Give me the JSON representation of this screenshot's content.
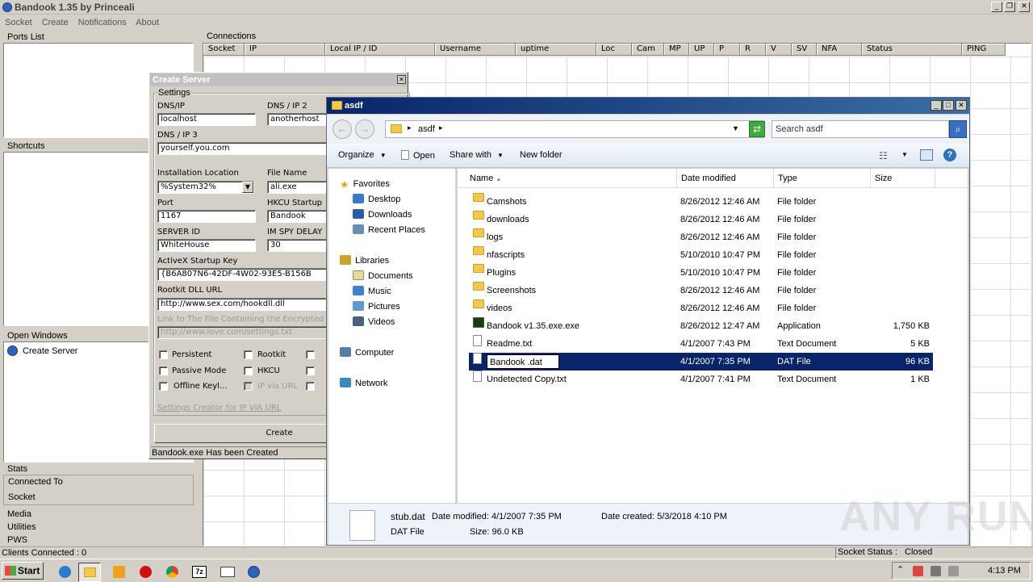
{
  "main_window": {
    "title": "Bandook 1.35 by Princeali",
    "menu": [
      "Socket",
      "Create",
      "Notifications",
      "About"
    ]
  },
  "left_panel": {
    "ports_list_label": "Ports List",
    "shortcuts_label": "Shortcuts",
    "open_windows_label": "Open Windows",
    "open_windows_items": [
      "Create Server"
    ],
    "stats_label": "Stats",
    "connected_to_label": "Connected To",
    "socket_label": "Socket",
    "shortcut_links": [
      "Media",
      "Utilities",
      "PWS"
    ]
  },
  "connections": {
    "label": "Connections",
    "columns": [
      "Socket",
      "IP",
      "Local IP / ID",
      "Username",
      "uptime",
      "Loc",
      "Cam",
      "MP",
      "UP",
      "P",
      "R",
      "V",
      "SV",
      "NFA",
      "Status",
      "PING"
    ]
  },
  "status_bar": {
    "clients": "Clients Connected : 0",
    "socket_status_label": "Socket Status :",
    "socket_status_value": "Closed"
  },
  "create_server": {
    "title": "Create Server",
    "settings_label": "Settings",
    "dns_ip_label": "DNS/IP",
    "dns_ip_value": "localhost",
    "dns_ip2_label": "DNS / IP 2",
    "dns_ip2_value": "anotherhost",
    "dns_ip3_label": "DNS / IP 3",
    "dns_ip3_value": "yourself.you.com",
    "install_location_label": "Installation Location",
    "install_location_value": "%System32%",
    "file_name_label": "File Name",
    "file_name_value": "ali.exe",
    "port_label": "Port",
    "port_value": "1167",
    "hkcu_label": "HKCU Startup",
    "hkcu_value": "Bandook",
    "server_id_label": "SERVER ID",
    "server_id_value": "WhiteHouse",
    "im_spy_label": "IM SPY DELAY",
    "im_spy_value": "30",
    "activex_label": "ActiveX Startup Key",
    "activex_value": "{B6A807N6-42DF-4W02-93E5-B156B",
    "rootkit_url_label": "Rootkit DLL URL",
    "rootkit_url_value": "http://www.sex.com/hookdll.dll",
    "link_file_label": "Link to The File Containing the Encrypted",
    "link_file_value": "http://www.love.com/settings.txt",
    "checkboxes": [
      "Persistent",
      "Rootkit",
      "Passive Mode",
      "HKCU",
      "Offline Keyl...",
      "IP via URL"
    ],
    "settings_creator_link": "Settings Creator for IP VIA URL",
    "create_button": "Create",
    "status": "Bandook.exe Has been Created"
  },
  "explorer": {
    "title": "asdf",
    "breadcrumb": "asdf",
    "search_placeholder": "Search asdf",
    "toolbar": {
      "organize": "Organize",
      "open": "Open",
      "share_with": "Share with",
      "new_folder": "New folder"
    },
    "nav": {
      "favorites": "Favorites",
      "favorites_items": [
        "Desktop",
        "Downloads",
        "Recent Places"
      ],
      "libraries": "Libraries",
      "libraries_items": [
        "Documents",
        "Music",
        "Pictures",
        "Videos"
      ],
      "computer": "Computer",
      "network": "Network"
    },
    "columns": {
      "name": "Name",
      "date": "Date modified",
      "type": "Type",
      "size": "Size"
    },
    "files": [
      {
        "name": "Camshots",
        "date": "8/26/2012 12:46 AM",
        "type": "File folder",
        "size": ""
      },
      {
        "name": "downloads",
        "date": "8/26/2012 12:46 AM",
        "type": "File folder",
        "size": ""
      },
      {
        "name": "logs",
        "date": "8/26/2012 12:46 AM",
        "type": "File folder",
        "size": ""
      },
      {
        "name": "nfascripts",
        "date": "5/10/2010 10:47 PM",
        "type": "File folder",
        "size": ""
      },
      {
        "name": "Plugins",
        "date": "5/10/2010 10:47 PM",
        "type": "File folder",
        "size": ""
      },
      {
        "name": "Screenshots",
        "date": "8/26/2012 12:46 AM",
        "type": "File folder",
        "size": ""
      },
      {
        "name": "videos",
        "date": "8/26/2012 12:46 AM",
        "type": "File folder",
        "size": ""
      },
      {
        "name": "Bandook v1.35.exe.exe",
        "date": "8/26/2012 12:47 AM",
        "type": "Application",
        "size": "1,750 KB"
      },
      {
        "name": "Readme.txt",
        "date": "4/1/2007 7:43 PM",
        "type": "Text Document",
        "size": "5 KB"
      },
      {
        "name": "Bandook .dat",
        "date": "4/1/2007 7:35 PM",
        "type": "DAT File",
        "size": "96 KB"
      },
      {
        "name": "Undetected Copy.txt",
        "date": "4/1/2007 7:41 PM",
        "type": "Text Document",
        "size": "1 KB"
      }
    ],
    "details": {
      "filename": "stub.dat",
      "date_modified": "Date modified: 4/1/2007 7:35 PM",
      "date_created": "Date created: 5/3/2018 4:10 PM",
      "type": "DAT File",
      "size": "Size: 96.0 KB"
    }
  },
  "taskbar": {
    "start": "Start",
    "time": "4:13 PM"
  },
  "watermark": "ANY RUN"
}
